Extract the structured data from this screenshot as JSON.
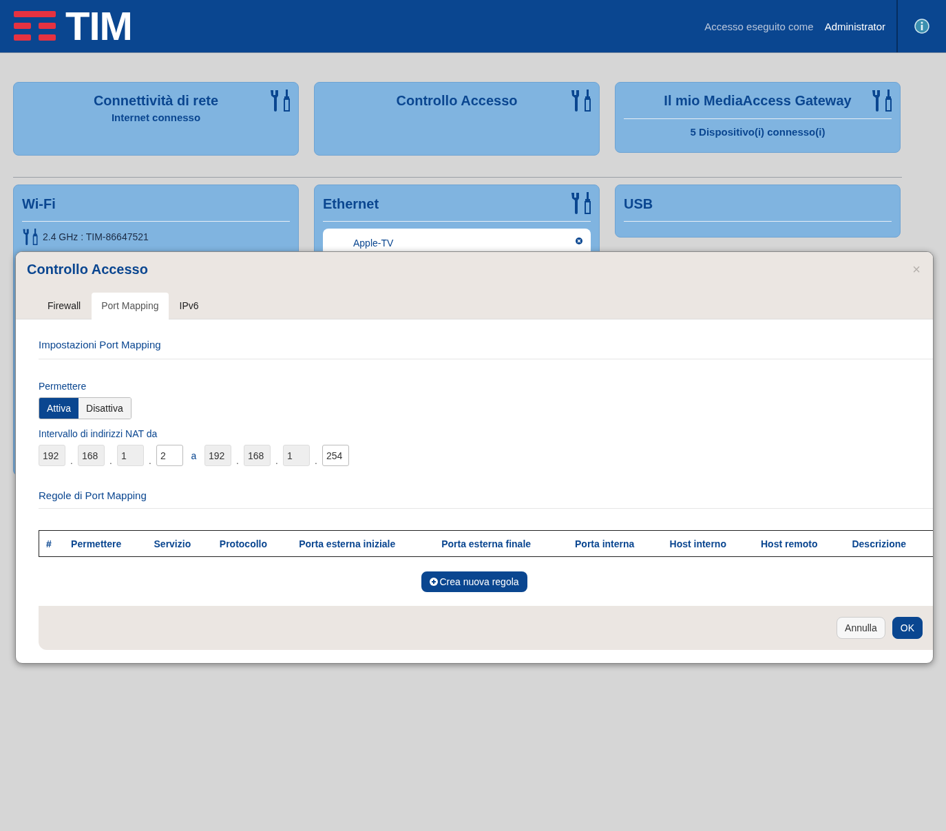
{
  "header": {
    "logo_text": "TIM",
    "login_prefix": "Accesso eseguito come",
    "user": "Administrator"
  },
  "top_cards": [
    {
      "kind": "plain",
      "title": "Connettività di rete",
      "subtitle": "Internet connesso",
      "tools": true
    },
    {
      "kind": "plain",
      "title": "Controllo Accesso",
      "tools": true
    },
    {
      "kind": "divided",
      "title": "Il mio MediaAccess Gateway",
      "subtitle": "5 Dispositivo(i) connesso(i)",
      "tools": true
    }
  ],
  "bottom_cards": [
    {
      "kind": "wifi",
      "title": "Wi-Fi",
      "tools": false,
      "item": "2.4 GHz : TIM-86647521"
    },
    {
      "kind": "ethernet",
      "title": "Ethernet",
      "tools": true,
      "device": "Apple-TV"
    },
    {
      "kind": "usb",
      "title": "USB",
      "tools": false
    }
  ],
  "modal": {
    "title": "Controllo Accesso",
    "close": "×",
    "tabs": [
      {
        "label": "Firewall",
        "selected": false
      },
      {
        "label": "Port Mapping",
        "selected": true
      },
      {
        "label": "IPv6",
        "selected": false
      }
    ],
    "settings_heading": "Impostazioni Port Mapping",
    "allow_label": "Permettere",
    "toggle": [
      {
        "label": "Attiva",
        "selected": true
      },
      {
        "label": "Disattiva",
        "selected": false
      }
    ],
    "nat_label": "Intervallo di indirizzi NAT da",
    "nat_from": [
      {
        "value": "192",
        "disabled": true
      },
      {
        "value": "168",
        "disabled": true
      },
      {
        "value": "1",
        "disabled": true
      },
      {
        "value": "2",
        "disabled": false
      }
    ],
    "octet_separator": ".",
    "nat_to_word": "a",
    "nat_to": [
      {
        "value": "192",
        "disabled": true
      },
      {
        "value": "168",
        "disabled": true
      },
      {
        "value": "1",
        "disabled": true
      },
      {
        "value": "254",
        "disabled": false
      }
    ],
    "rules_heading": "Regole di Port Mapping",
    "columns": [
      "#",
      "Permettere",
      "Servizio",
      "Protocollo",
      "Porta esterna iniziale",
      "Porta esterna finale",
      "Porta interna",
      "Host interno",
      "Host remoto",
      "Descrizione"
    ],
    "new_rule": "Crea nuova regola",
    "buttons": [
      {
        "kind": "secondary",
        "label": "Annulla"
      },
      {
        "kind": "primary",
        "label": "OK"
      }
    ]
  }
}
